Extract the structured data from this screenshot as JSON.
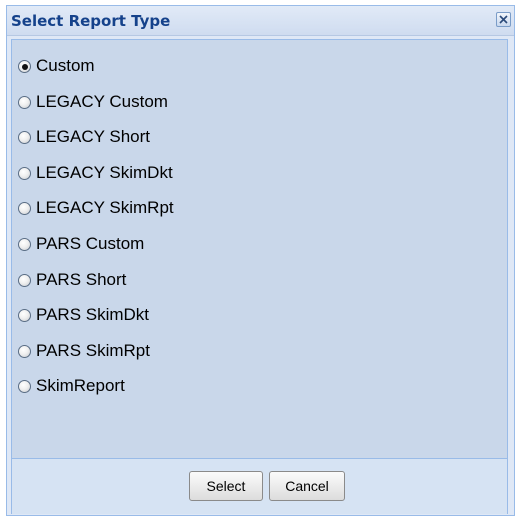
{
  "dialog": {
    "title": "Select Report Type",
    "close_icon": "close-icon",
    "options": [
      {
        "label": "Custom",
        "checked": true
      },
      {
        "label": "LEGACY Custom",
        "checked": false
      },
      {
        "label": "LEGACY Short",
        "checked": false
      },
      {
        "label": "LEGACY SkimDkt",
        "checked": false
      },
      {
        "label": "LEGACY SkimRpt",
        "checked": false
      },
      {
        "label": "PARS Custom",
        "checked": false
      },
      {
        "label": "PARS Short",
        "checked": false
      },
      {
        "label": "PARS SkimDkt",
        "checked": false
      },
      {
        "label": "PARS SkimRpt",
        "checked": false
      },
      {
        "label": "SkimReport",
        "checked": false
      }
    ],
    "buttons": {
      "select_label": "Select",
      "cancel_label": "Cancel"
    }
  },
  "colors": {
    "title_text": "#15428b",
    "panel_background": "#c9d7ea",
    "border": "#99bbe8"
  }
}
